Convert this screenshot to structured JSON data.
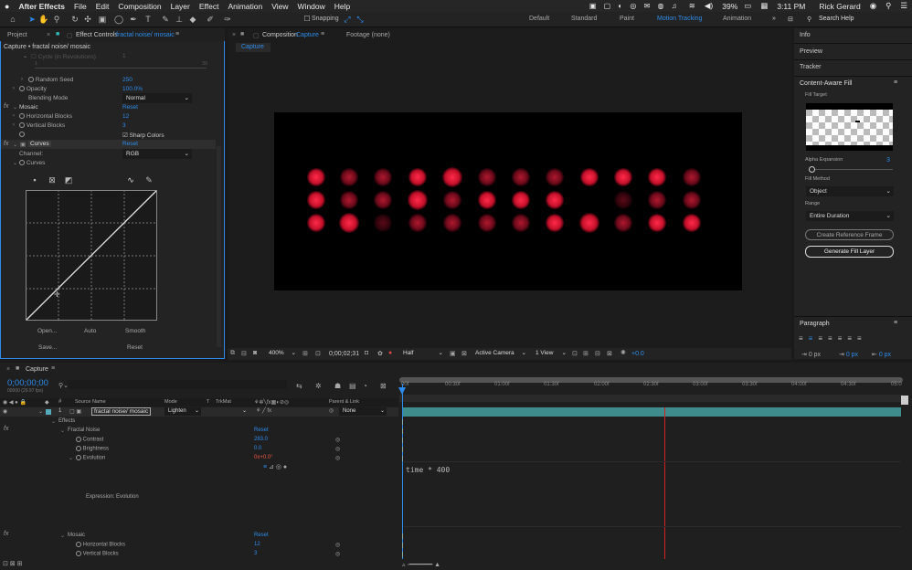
{
  "menubar": {
    "apple": "",
    "app": "After Effects",
    "items": [
      "File",
      "Edit",
      "Composition",
      "Layer",
      "Effect",
      "Animation",
      "View",
      "Window",
      "Help"
    ],
    "battery": "39%",
    "time": "3:11 PM",
    "user": "Rick Gerard"
  },
  "toolbar": {
    "snapping": "Snapping",
    "workspaces": [
      "Default",
      "Standard",
      "Paint",
      "Motion Tracking",
      "Animation"
    ],
    "search": "Search Help"
  },
  "left_panel": {
    "tab_project": "Project",
    "tab_effect": "Effect Controls",
    "effect_layer": "fractal noise/ mosaic",
    "breadcrumb": "Capture • fractal noise/ mosaic",
    "cycle_label": "Cycle (in Revolutions)",
    "cycle_val": "1",
    "slider_min": "1",
    "slider_max": "30",
    "random_seed_label": "Random Seed",
    "random_seed_val": "250",
    "opacity_label": "Opacity",
    "opacity_val": "100.0%",
    "blending_label": "Blending Mode",
    "blending_val": "Normal",
    "mosaic_label": "Mosaic",
    "reset": "Reset",
    "hblocks_label": "Horizontal Blocks",
    "hblocks_val": "12",
    "vblocks_label": "Vertical Blocks",
    "vblocks_val": "3",
    "sharp_colors": "Sharp Colors",
    "curves_label": "Curves",
    "channel_label": "Channel:",
    "channel_val": "RGB",
    "curves_sub": "Curves",
    "open": "Open...",
    "auto": "Auto",
    "smooth": "Smooth",
    "save": "Save...",
    "reset2": "Reset"
  },
  "comp_panel": {
    "tab_comp": "Composition",
    "comp_name": "Capture",
    "tab_footage": "Footage (none)",
    "flow_tab": "Capture",
    "zoom": "400%",
    "timecode": "0;00;02;31",
    "resolution": "Half",
    "camera": "Active Camera",
    "view": "1 View",
    "exposure": "+0.0"
  },
  "right_panel": {
    "info": "Info",
    "preview": "Preview",
    "tracker": "Tracker",
    "caf_title": "Content-Aware Fill",
    "fill_target": "Fill Target",
    "alpha_expansion": "Alpha Expansion",
    "alpha_val": "3",
    "fill_method": "Fill Method",
    "fill_method_val": "Object",
    "range": "Range",
    "range_val": "Entire Duration",
    "create_ref": "Create Reference Frame",
    "generate": "Generate Fill Layer",
    "paragraph": "Paragraph",
    "px1": "0 px",
    "px2": "0 px",
    "px3": "0 px"
  },
  "timeline": {
    "comp_tab": "Capture",
    "timecode": "0;00;00;00",
    "fps": "00000 (29.97 fps)",
    "col_source": "Source Name",
    "col_mode": "Mode",
    "col_t": "T",
    "col_trkmat": "TrkMat",
    "col_parent": "Parent & Link",
    "layer_num": "1",
    "layer_name": "fractal noise/ mosaic",
    "layer_mode": "Lighten",
    "parent": "None",
    "effects": "Effects",
    "fractal_noise": "Fractal Noise",
    "reset": "Reset",
    "contrast_label": "Contrast",
    "contrast_val": "283.0",
    "brightness_label": "Brightness",
    "brightness_val": "0.0",
    "evolution_label": "Evolution",
    "evolution_val": "0x+0.0°",
    "expr_label": "Expression: Evolution",
    "expression": "time * 400",
    "mosaic": "Mosaic",
    "hblocks_label": "Horizontal Blocks",
    "hblocks_val": "12",
    "vblocks_label": "Vertical Blocks",
    "vblocks_val": "3",
    "ticks": [
      "00f",
      "00:30f",
      "01:00f",
      "01:30f",
      "02:00f",
      "02:30f",
      "03:00f",
      "03:30f",
      "04:00f",
      "04:30f",
      "05:0"
    ]
  },
  "colors": {
    "accent": "#2d8ceb",
    "panel": "#232323",
    "bg": "#1a1a1a",
    "layer_bar": "#3f8c8c",
    "playhead": "#d02020",
    "dot_red": "#ff1e3c"
  }
}
